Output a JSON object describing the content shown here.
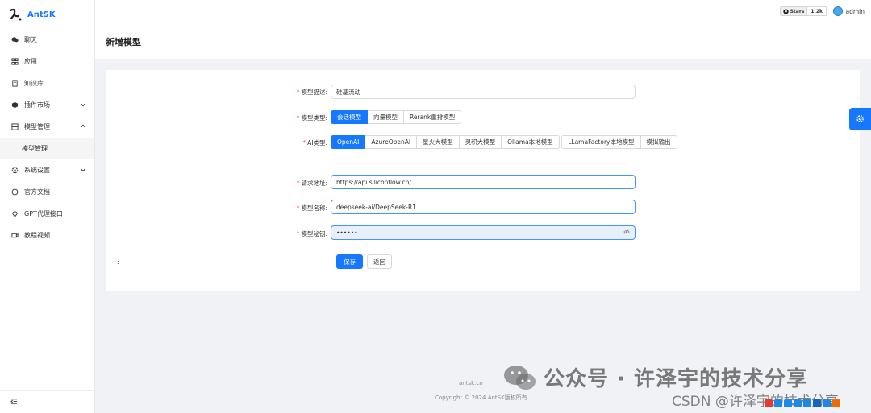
{
  "app": {
    "name": "AntSK"
  },
  "sidebar": {
    "items": [
      {
        "label": "聊天",
        "icon": "chat-icon"
      },
      {
        "label": "应用",
        "icon": "apps-icon"
      },
      {
        "label": "知识库",
        "icon": "book-icon"
      },
      {
        "label": "插件市场",
        "icon": "plugin-icon"
      },
      {
        "label": "模型管理",
        "icon": "model-icon"
      },
      {
        "label": "系统设置",
        "icon": "settings-icon"
      },
      {
        "label": "官方文档",
        "icon": "doc-icon"
      },
      {
        "label": "GPT代理接口",
        "icon": "location-icon"
      },
      {
        "label": "教程视频",
        "icon": "video-icon"
      }
    ],
    "submenu": {
      "label": "模型管理"
    }
  },
  "topbar": {
    "github_stars_label": "Stars",
    "github_stars_count": "1.2k",
    "user_name": "admin"
  },
  "page": {
    "title": "新增模型"
  },
  "form": {
    "description": {
      "label": "模型描述:",
      "value": "硅基流动"
    },
    "model_type": {
      "label": "模型类型:",
      "options": [
        "会话模型",
        "向量模型",
        "Rerank重排模型"
      ],
      "selected": "会话模型"
    },
    "ai_type": {
      "label": "AI类型:",
      "options_row1": [
        "OpenAI",
        "AzureOpenAI",
        "星火大模型",
        "灵积大模型",
        "Ollama本地模型"
      ],
      "options_row2": [
        "LLamaFactory本地模型",
        "模拟输出"
      ],
      "selected": "OpenAI"
    },
    "endpoint": {
      "label": "请求地址:",
      "value": "https://api.siliconflow.cn/"
    },
    "model_name": {
      "label": "模型名称:",
      "value": "deepseek-ai/DeepSeek-R1"
    },
    "api_key": {
      "label": "模型秘钥:",
      "value": "••••••"
    },
    "extra_label": ":",
    "save_label": "保存",
    "back_label": "返回"
  },
  "footer": {
    "link": "antsk.cn",
    "copyright": "Copyright © 2024 AntSK版权所有"
  },
  "watermark": {
    "line1": "公众号 · 许泽宇的技术分享",
    "line2": "CSDN @许泽宇的技术分享"
  },
  "colors": {
    "primary": "#1677ff",
    "required": "#ff4d4f"
  }
}
